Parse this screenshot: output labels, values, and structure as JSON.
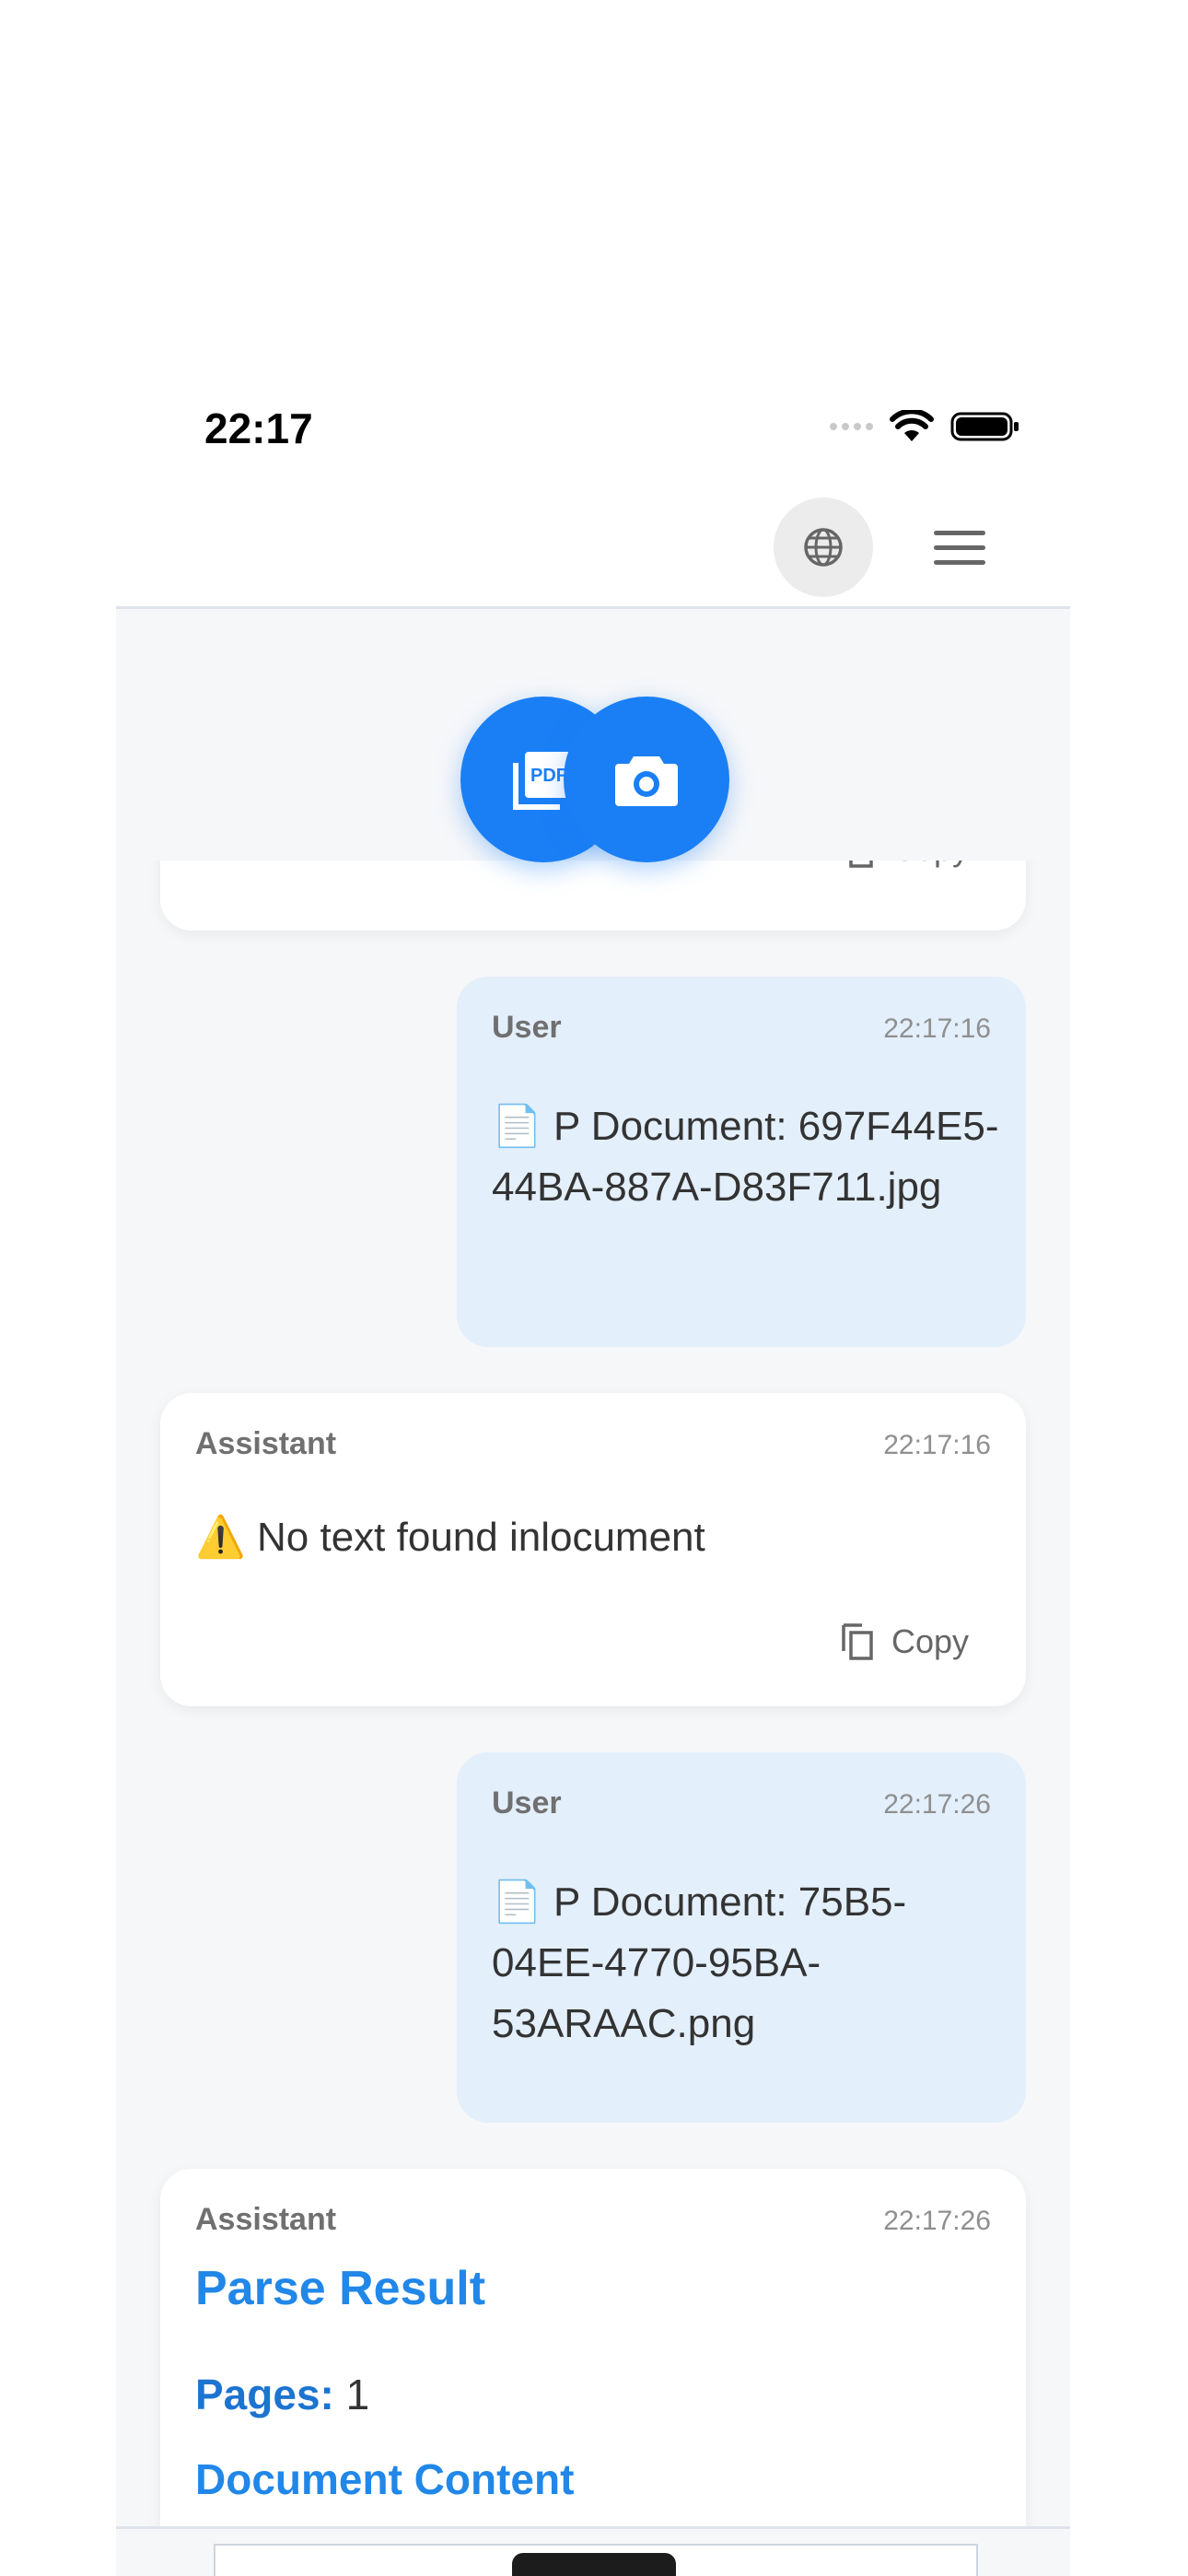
{
  "status_bar": {
    "time": "22:17"
  },
  "header": {
    "globe_icon": "globe-icon",
    "menu_icon": "hamburger-menu-icon"
  },
  "fab": {
    "pdf_icon": "pdf-icon",
    "camera_icon": "camera-icon"
  },
  "colors": {
    "accent": "#1a7ff5",
    "user_bubble": "#e3effb",
    "heading_blue": "#2187e8"
  },
  "messages": [
    {
      "role": "",
      "time": "",
      "copy_label": "Copy"
    },
    {
      "role": "User",
      "time": "22:17:16",
      "text": "📄 P Document: 697F44E5-44BA-887A-D83F711.jpg"
    },
    {
      "role": "Assistant",
      "time": "22:17:16",
      "text": "⚠️ No text found inlocument",
      "copy_label": "Copy"
    },
    {
      "role": "User",
      "time": "22:17:26",
      "text": "📄 P Document: 75B5-04EE-4770-95BA-53ARAAC.png"
    },
    {
      "role": "Assistant",
      "time": "22:17:26",
      "title": "Parse Result",
      "pages_label": "Pages:",
      "pages_value": "1",
      "content_heading": "Document Content"
    }
  ]
}
